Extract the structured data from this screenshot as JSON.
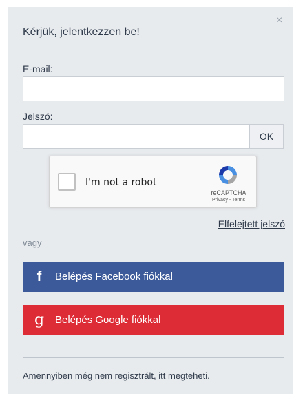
{
  "dialog": {
    "close_symbol": "×",
    "title": "Kérjük, jelentkezzen be!"
  },
  "form": {
    "email_label": "E-mail:",
    "email_value": "",
    "password_label": "Jelszó:",
    "password_value": "",
    "ok_label": "OK",
    "forgot_link": "Elfelejtett jelszó"
  },
  "recaptcha": {
    "label": "I'm not a robot",
    "brand": "reCAPTCHA",
    "privacy": "Privacy",
    "separator": " - ",
    "terms": "Terms",
    "checked": false
  },
  "social": {
    "or_label": "vagy",
    "facebook": {
      "icon": "facebook-icon",
      "glyph": "f",
      "label": "Belépés Facebook fiókkal",
      "color": "#3c5a9a"
    },
    "google": {
      "icon": "google-icon",
      "glyph": "g",
      "label": "Belépés Google fiókkal",
      "color": "#dd2c35"
    }
  },
  "footer": {
    "text_before": "Amennyiben még nem regisztrált, ",
    "link": "itt",
    "text_after": " megteheti."
  },
  "colors": {
    "panel_bg": "#e8ebee",
    "text": "#2f3a4a"
  }
}
